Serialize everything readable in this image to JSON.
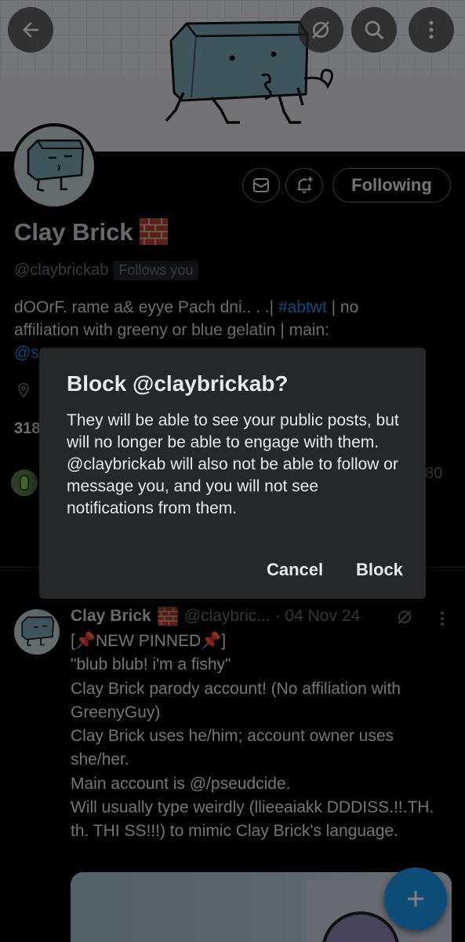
{
  "header": {
    "back_icon": "arrow-left-icon",
    "sync_icon": "sync-off-icon",
    "search_icon": "search-icon",
    "more_icon": "more-vertical-icon"
  },
  "profile": {
    "actions": {
      "message_icon": "envelope-icon",
      "notify_icon": "bell-plus-icon",
      "following_label": "Following"
    },
    "name": "Clay Brick",
    "handle": "@claybrickab",
    "follows_you": "Follows you",
    "bio_line1_text": "dOOrF. rame a& eyye Pach dni.. . .| ",
    "bio_hashtag": "#abtwt",
    "bio_line1_tail": " | no",
    "bio_line2": "affiliation with greeny or blue gelatin | main:",
    "bio_line3_link": "@s",
    "following_count": "318",
    "followers_tail": "80"
  },
  "dialog": {
    "title": "Block @claybrickab?",
    "body": "They will be able to see your public posts, but will no longer be able to engage with them. @claybrickab will also not be able to follow or message you, and you will not see notifications from them.",
    "cancel_label": "Cancel",
    "confirm_label": "Block"
  },
  "post": {
    "author": "Clay Brick",
    "handle_meta": "@claybric... · 04 Nov 24",
    "text": "[📌NEW PINNED📌]\n\"blub blub! i'm a fishy\"\nClay Brick parody account! (No affiliation with GreenyGuy)\nClay Brick uses he/him; account owner uses she/her.\nMain account is @/pseudcide.\nWill usually type weirdly (llieeaiakk DDDISS.!!.TH. th. THI SS!!!) to mimic Clay Brick's language."
  },
  "fab": {
    "icon": "plus-icon"
  },
  "colors": {
    "accent": "#1d9bf0",
    "background": "#000000",
    "dialog": "#262728"
  }
}
